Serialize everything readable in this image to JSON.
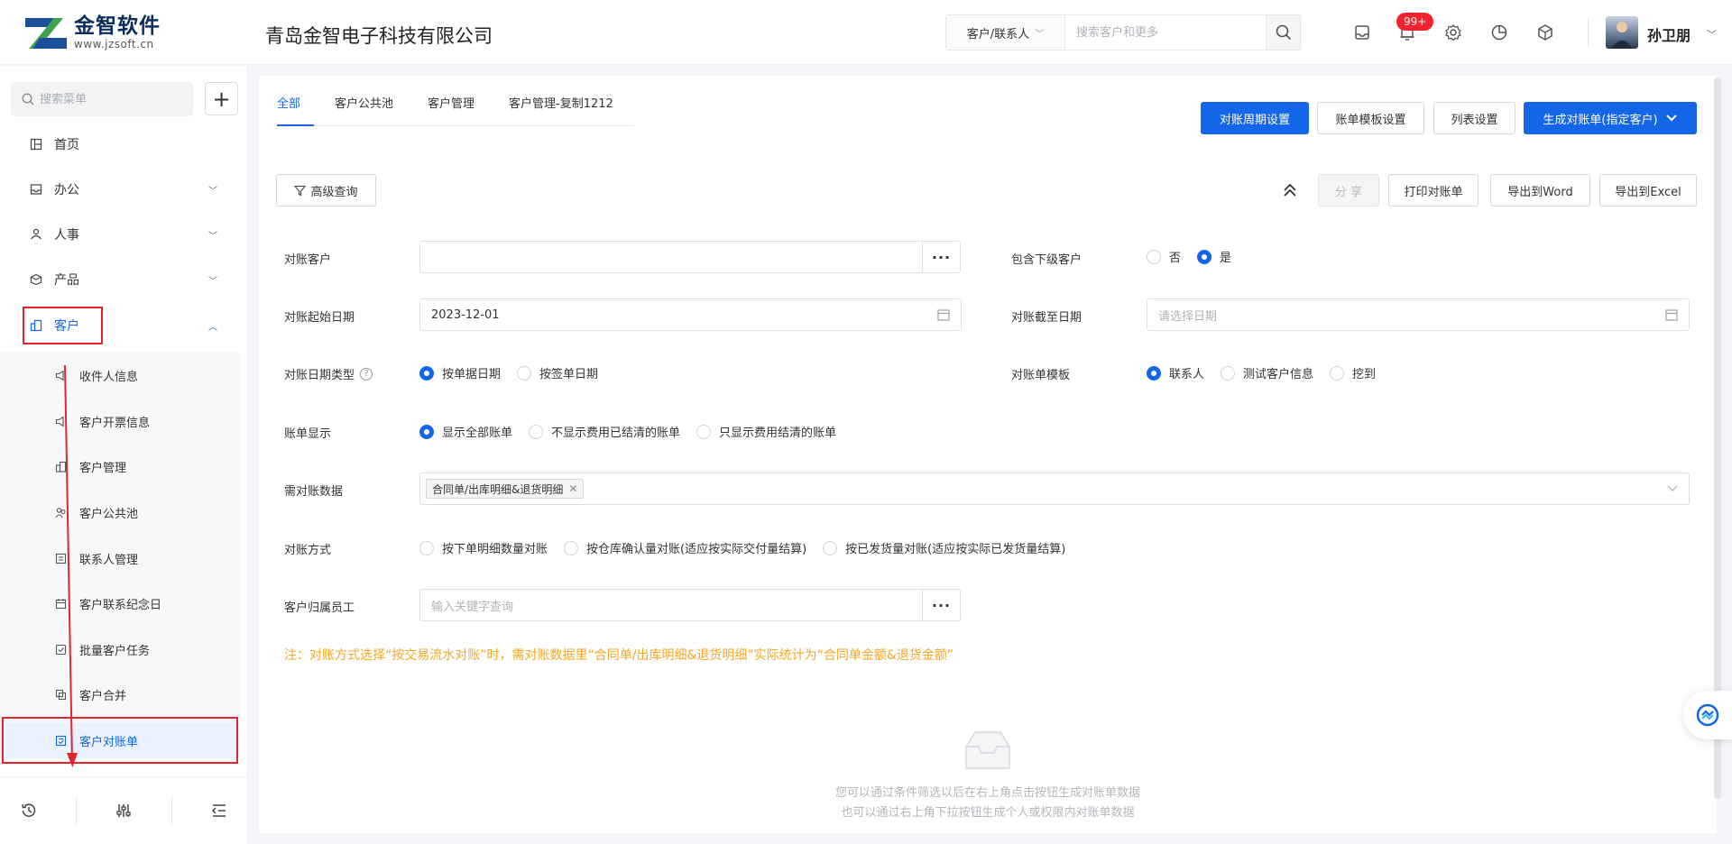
{
  "brand": {
    "name_cn": "金智软件",
    "url": "www.jzsoft.cn",
    "company": "青岛金智电子科技有限公司"
  },
  "header": {
    "search_scope": "客户/联系人",
    "search_placeholder": "搜索客户和更多",
    "notification_count": "99+",
    "user_name": "孙卫朋"
  },
  "sidebar": {
    "search_placeholder": "搜索菜单",
    "add_label": "+",
    "items": [
      {
        "label": "首页"
      },
      {
        "label": "办公"
      },
      {
        "label": "人事"
      },
      {
        "label": "产品"
      },
      {
        "label": "客户"
      }
    ],
    "sub_items": [
      {
        "label": "收件人信息"
      },
      {
        "label": "客户开票信息"
      },
      {
        "label": "客户管理"
      },
      {
        "label": "客户公共池"
      },
      {
        "label": "联系人管理"
      },
      {
        "label": "客户联系纪念日"
      },
      {
        "label": "批量客户任务"
      },
      {
        "label": "客户合并"
      },
      {
        "label": "客户对账单"
      }
    ]
  },
  "tabs": [
    {
      "label": "全部"
    },
    {
      "label": "客户公共池"
    },
    {
      "label": "客户管理"
    },
    {
      "label": "客户管理-复制1212"
    }
  ],
  "toolbar": {
    "period_setting": "对账周期设置",
    "template_setting": "账单模板设置",
    "list_setting": "列表设置",
    "generate": "生成对账单(指定客户)",
    "advanced_query": "高级查询",
    "share": "分 享",
    "print": "打印对账单",
    "export_word": "导出到Word",
    "export_excel": "导出到Excel"
  },
  "form": {
    "customer_label": "对账客户",
    "include_sub_label": "包含下级客户",
    "include_sub_options": [
      "否",
      "是"
    ],
    "start_date_label": "对账起始日期",
    "start_date_value": "2023-12-01",
    "end_date_label": "对账截至日期",
    "end_date_placeholder": "请选择日期",
    "date_type_label": "对账日期类型",
    "date_type_options": [
      "按单据日期",
      "按签单日期"
    ],
    "template_label": "对账单模板",
    "template_options": [
      "联系人",
      "测试客户信息",
      "挖到"
    ],
    "bill_display_label": "账单显示",
    "bill_display_options": [
      "显示全部账单",
      "不显示费用已结清的账单",
      "只显示费用结清的账单"
    ],
    "data_label": "需对账数据",
    "data_tag": "合同单/出库明细&退货明细",
    "method_label": "对账方式",
    "method_options": [
      "按下单明细数量对账",
      "按仓库确认量对账(适应按实际交付量结算)",
      "按已发货量对账(适应按实际已发货量结算)"
    ],
    "staff_label": "客户归属员工",
    "staff_placeholder": "输入关键字查询",
    "ellipsis": "···"
  },
  "note": "注：对账方式选择“按交易流水对账”时，需对账数据里“合同单/出库明细&退货明细”实际统计为“合同单金额&退货金额”",
  "empty": {
    "line1": "您可以通过条件筛选以后在右上角点击按钮生成对账单数据",
    "line2": "也可以通过右上角下拉按钮生成个人或权限内对账单数据"
  }
}
